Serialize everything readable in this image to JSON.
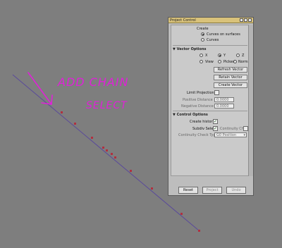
{
  "annotation": {
    "line1": "ADD CHAIN",
    "line2": "SELECT"
  },
  "panel": {
    "title": "Project Control",
    "create": {
      "label": "Create",
      "options": [
        "Curves on surfaces",
        "Curves"
      ],
      "selected": "Curves on surfaces"
    },
    "vector_options": {
      "label": "Vector Options",
      "axes": [
        "X",
        "Y",
        "Z"
      ],
      "modes": [
        "View",
        "Picked",
        "Normal"
      ],
      "selected": "Y",
      "refresh_button": "Refresh Vector",
      "retain_button": "Retain Vector",
      "create_button": "Create Vector",
      "limit_projection": "Limit Projection",
      "positive_distance_label": "Positive Distance",
      "positive_distance_value": "0.0000",
      "negative_distance_label": "Negative Distance",
      "negative_distance_value": "0.0000"
    },
    "control_options": {
      "label": "Control Options",
      "create_history": "Create history",
      "create_history_checked": true,
      "subdiv_select": "Subdiv Select",
      "subdiv_select_checked": true,
      "continuity_check": "Continuity Check",
      "continuity_check_checked": false,
      "continuity_check_type_label": "Continuity Check Type",
      "continuity_check_type_value": "G0 Position"
    },
    "buttons": {
      "reset": "Reset",
      "project": "Project",
      "undo": "Undo"
    }
  },
  "colors": {
    "annotation": "#e020d8",
    "curve": "#5a4a9a",
    "points": "#b03040"
  }
}
